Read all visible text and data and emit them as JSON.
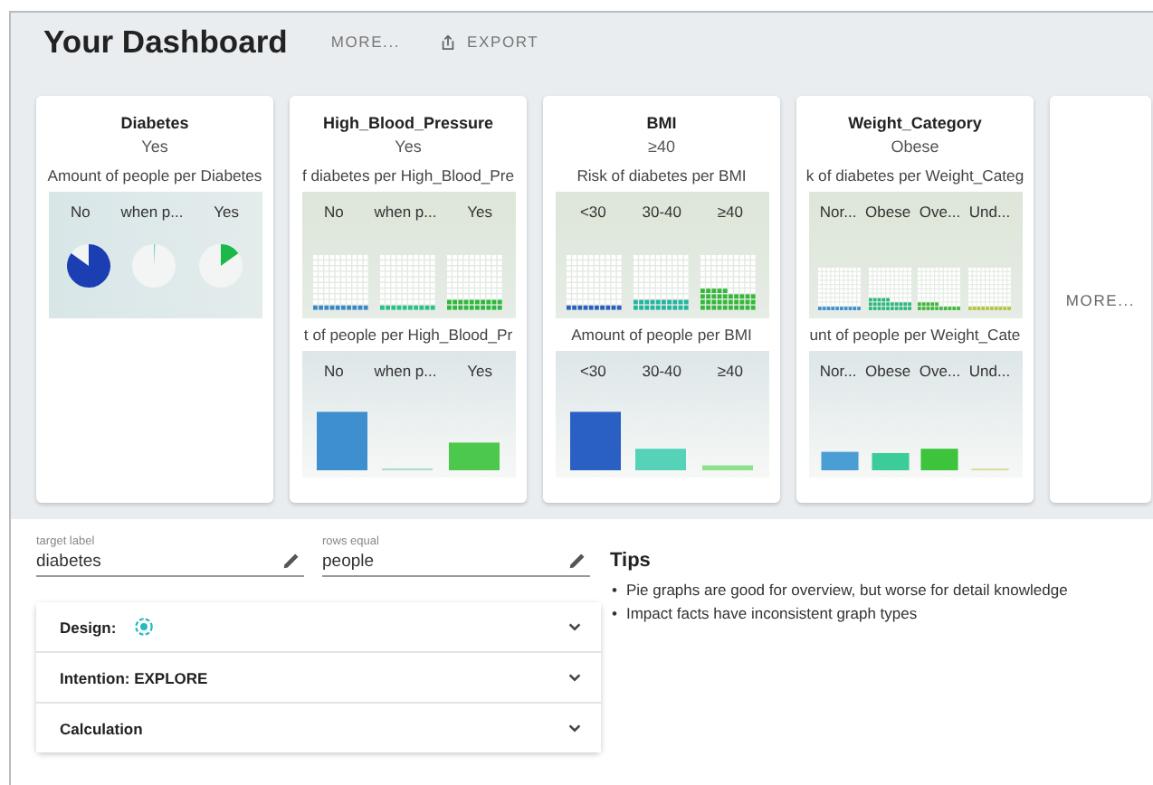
{
  "header": {
    "title": "Your Dashboard",
    "more": "MORE...",
    "export": "EXPORT"
  },
  "cards": [
    {
      "title": "Diabetes",
      "value": "Yes",
      "charts": [
        {
          "kind": "pie",
          "title": "Amount of people per Diabetes",
          "categories": [
            {
              "label": "No",
              "color": "#1b3fb3"
            },
            {
              "label": "when p...",
              "color": "#7ecfd8"
            },
            {
              "label": "Yes",
              "color": "#1bb84a"
            }
          ]
        }
      ]
    },
    {
      "title": "High_Blood_Pressure",
      "value": "Yes",
      "charts": [
        {
          "kind": "waffle",
          "title": "f diabetes per High_Blood_Pre",
          "categories": [
            {
              "label": "No",
              "color": "#3a86c8"
            },
            {
              "label": "when p...",
              "color": "#2bbf8a"
            },
            {
              "label": "Yes",
              "color": "#2db83a"
            }
          ]
        },
        {
          "kind": "bar",
          "title": "t of people per High_Blood_Pr",
          "categories": [
            {
              "label": "No",
              "color": "#3d8fd0"
            },
            {
              "label": "when p...",
              "color": "#a8dcd4"
            },
            {
              "label": "Yes",
              "color": "#4cc94c"
            }
          ]
        }
      ]
    },
    {
      "title": "BMI",
      "value": "≥40",
      "charts": [
        {
          "kind": "waffle",
          "title": "Risk of diabetes per BMI",
          "categories": [
            {
              "label": "<30",
              "color": "#2c5fc2"
            },
            {
              "label": "30-40",
              "color": "#22b5a0"
            },
            {
              "label": "≥40",
              "color": "#35b83a"
            }
          ]
        },
        {
          "kind": "bar",
          "title": "Amount of people per BMI",
          "categories": [
            {
              "label": "<30",
              "color": "#2a5fc4"
            },
            {
              "label": "30-40",
              "color": "#56d2b8"
            },
            {
              "label": "≥40",
              "color": "#8ee08e"
            }
          ]
        }
      ]
    },
    {
      "title": "Weight_Category",
      "value": "Obese",
      "charts": [
        {
          "kind": "waffle",
          "title": "k of diabetes per Weight_Categ",
          "categories": [
            {
              "label": "Nor...",
              "color": "#3a8ed0"
            },
            {
              "label": "Obese",
              "color": "#2ab880"
            },
            {
              "label": "Ove...",
              "color": "#3cb83a"
            },
            {
              "label": "Und...",
              "color": "#b8c23a"
            }
          ]
        },
        {
          "kind": "bar",
          "title": "unt of people per Weight_Cate",
          "categories": [
            {
              "label": "Nor...",
              "color": "#4a9ed4"
            },
            {
              "label": "Obese",
              "color": "#3ccc9a"
            },
            {
              "label": "Ove...",
              "color": "#3cc43c"
            },
            {
              "label": "Und...",
              "color": "#d8dc9a"
            }
          ]
        }
      ]
    }
  ],
  "more_card": "MORE...",
  "fields": [
    {
      "label": "target label",
      "value": "diabetes"
    },
    {
      "label": "rows equal",
      "value": "people"
    }
  ],
  "accordion": [
    {
      "title": "Design:",
      "kind": "icon",
      "expanded": false
    },
    {
      "title": "Intention: EXPLORE",
      "kind": "plain",
      "expanded": false
    },
    {
      "title": "Calculation",
      "kind": "plain",
      "expanded": false
    }
  ],
  "tips": {
    "title": "Tips",
    "items": [
      {
        "bullet": "•",
        "text": "Pie graphs are good for overview, but worse for detail knowledge"
      },
      {
        "bullet": "•",
        "text": "Impact facts have inconsistent graph types"
      }
    ]
  }
}
